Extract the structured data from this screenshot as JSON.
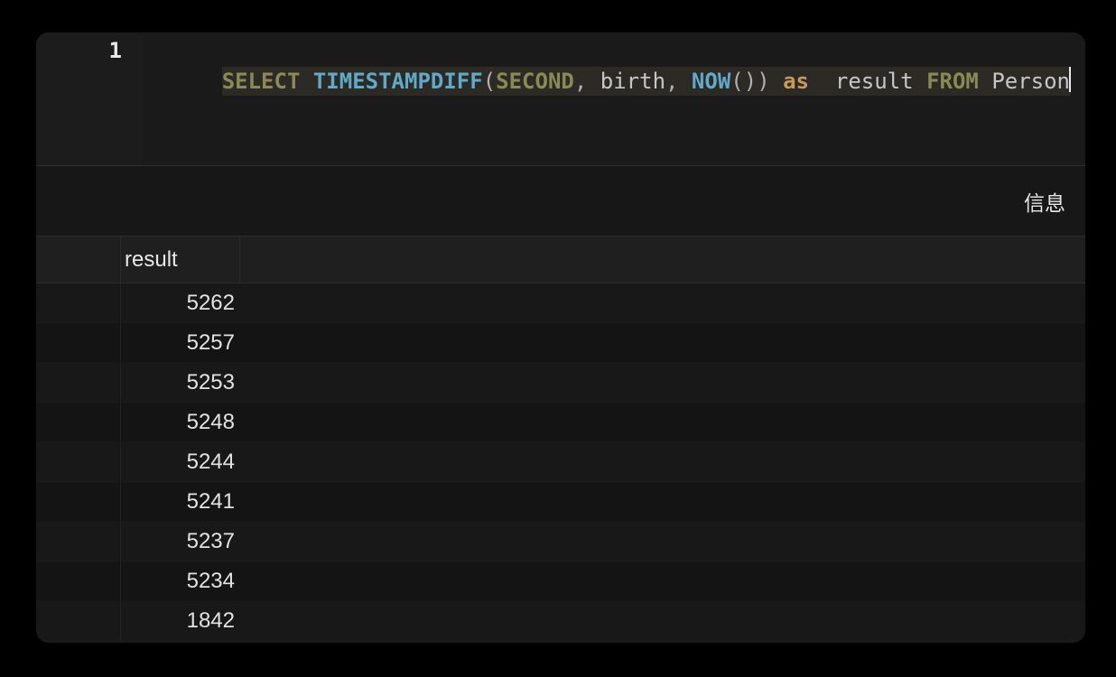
{
  "editor": {
    "line_number": "1",
    "tokens": {
      "select": "SELECT",
      "func": "TIMESTAMPDIFF",
      "lparen": "(",
      "arg_second": "SECOND",
      "comma1": ",",
      "space1": " ",
      "birth": "birth",
      "comma2": ",",
      "space2": " ",
      "now": "NOW",
      "now_par": "()",
      "rparen": ")",
      "space3": " ",
      "as": "as",
      "space4": "  ",
      "result": "result",
      "space5": " ",
      "from": "FROM",
      "space6": " ",
      "person": "Person"
    }
  },
  "tabs": {
    "info": "信息"
  },
  "results": {
    "column": "result",
    "rows": [
      "5262",
      "5257",
      "5253",
      "5248",
      "5244",
      "5241",
      "5237",
      "5234",
      "1842"
    ]
  }
}
